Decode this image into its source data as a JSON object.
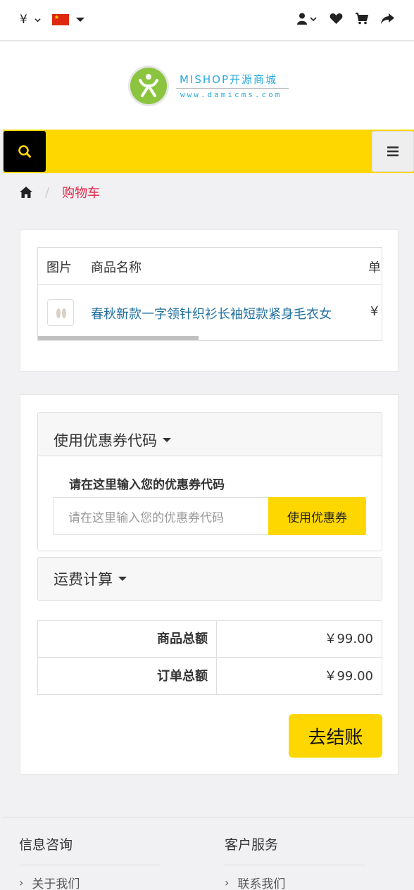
{
  "topbar": {
    "currency": "¥",
    "currency_icon": "chevron-down-icon",
    "language_flag": "china-flag",
    "icons": [
      "user-icon",
      "heart-icon",
      "cart-icon",
      "share-icon"
    ]
  },
  "logo": {
    "title": "MISHOP开源商城",
    "subtitle": "www.damicms.com"
  },
  "colors": {
    "accent_yellow": "#fed700",
    "link_blue": "#1e6f9f",
    "breadcrumb_red": "#e22547"
  },
  "breadcrumb": {
    "home_icon": "home-icon",
    "separator": "/",
    "current": "购物车"
  },
  "cart": {
    "headers": [
      "图片",
      "商品名称",
      "单"
    ],
    "items": [
      {
        "name": "春秋新款一字领针织衫长袖短款紧身毛衣女",
        "price": "¥"
      }
    ]
  },
  "coupon": {
    "title": "使用优惠券代码",
    "label": "请在这里输入您的优惠券代码",
    "placeholder": "请在这里输入您的优惠券代码",
    "button": "使用优惠券"
  },
  "shipping": {
    "title": "运费计算"
  },
  "totals": [
    {
      "label": "商品总额",
      "value": "￥99.00"
    },
    {
      "label": "订单总额",
      "value": "￥99.00"
    }
  ],
  "checkout": {
    "label": "去结账"
  },
  "footer": {
    "col1": {
      "title": "信息咨询",
      "link": "关于我们"
    },
    "col2": {
      "title": "客户服务",
      "link": "联系我们"
    }
  }
}
